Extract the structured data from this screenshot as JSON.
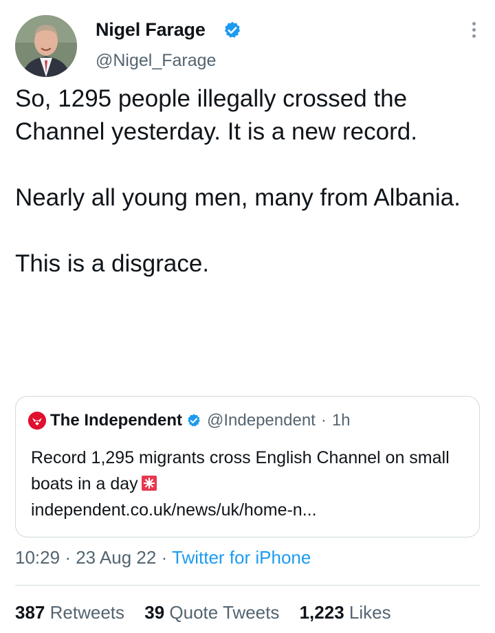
{
  "author": {
    "display_name": "Nigel Farage",
    "handle": "@Nigel_Farage",
    "verified": true
  },
  "tweet": {
    "text": "So, 1295 people illegally crossed the Channel yesterday. It is a new record.\n\nNearly all young men, many from Albania.\n\nThis is a disgrace."
  },
  "quoted": {
    "name": "The Independent",
    "handle": "@Independent",
    "separator": "·",
    "time": "1h",
    "text": "Record 1,295 migrants cross English Channel on small boats in a day",
    "emoji": "siren-icon",
    "link": "independent.co.uk/news/uk/home-n..."
  },
  "meta": {
    "time": "10:29",
    "sep1": "·",
    "date": "23 Aug 22",
    "sep2": "·",
    "source": "Twitter for iPhone"
  },
  "stats": {
    "retweets_count": "387",
    "retweets_label": "Retweets",
    "quotes_count": "39",
    "quotes_label": "Quote Tweets",
    "likes_count": "1,223",
    "likes_label": "Likes"
  },
  "colors": {
    "accent": "#1d9bf0",
    "secondary_text": "#536471",
    "independent_red": "#e0102e"
  }
}
